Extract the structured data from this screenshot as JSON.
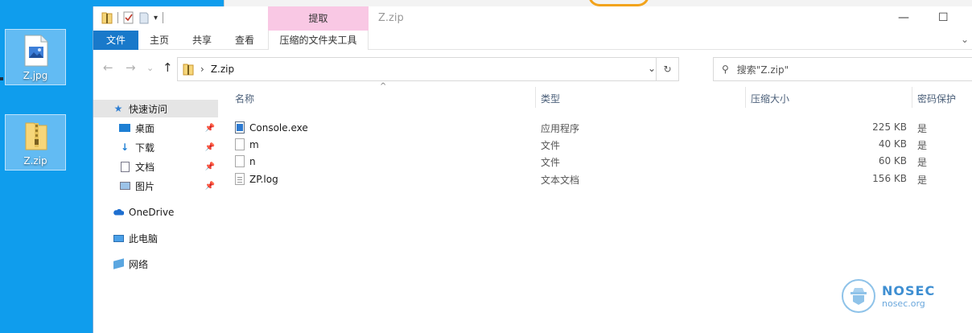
{
  "desktop": {
    "icons": [
      {
        "label": "Z.jpg",
        "icon": "image-file-icon"
      },
      {
        "label": "Z.zip",
        "icon": "zip-folder-icon"
      }
    ]
  },
  "window": {
    "title": "Z.zip",
    "contextual_tab_group": "提取",
    "ribbon_tabs": [
      {
        "label": "文件"
      },
      {
        "label": "主页"
      },
      {
        "label": "共享"
      },
      {
        "label": "查看"
      },
      {
        "label": "压缩的文件夹工具"
      }
    ],
    "address": {
      "path": "Z.zip"
    },
    "search": {
      "placeholder": "搜索\"Z.zip\""
    },
    "nav": {
      "quick_access": "快速访问",
      "items": [
        {
          "label": "桌面",
          "icon": "desktop-folder-icon"
        },
        {
          "label": "下载",
          "icon": "download-folder-icon"
        },
        {
          "label": "文档",
          "icon": "documents-folder-icon"
        },
        {
          "label": "图片",
          "icon": "pictures-folder-icon"
        }
      ],
      "onedrive": "OneDrive",
      "this_pc": "此电脑",
      "network": "网络"
    },
    "columns": {
      "name": "名称",
      "type": "类型",
      "size": "压缩大小",
      "password": "密码保护"
    },
    "files": [
      {
        "name": "Console.exe",
        "type": "应用程序",
        "size": "225 KB",
        "password": "是",
        "icon": "exe-file-icon"
      },
      {
        "name": "m",
        "type": "文件",
        "size": "40 KB",
        "password": "是",
        "icon": "blank-file-icon"
      },
      {
        "name": "n",
        "type": "文件",
        "size": "60 KB",
        "password": "是",
        "icon": "blank-file-icon"
      },
      {
        "name": "ZP.log",
        "type": "文本文档",
        "size": "156 KB",
        "password": "是",
        "icon": "text-file-icon"
      }
    ]
  },
  "watermark": {
    "line1": "NOSEC",
    "line2": "nosec.org"
  },
  "colors": {
    "accent": "#1979ca",
    "desktop_bg": "#0f9ded",
    "context_tab": "#f9c8e4",
    "selection": "#cce8ff"
  }
}
